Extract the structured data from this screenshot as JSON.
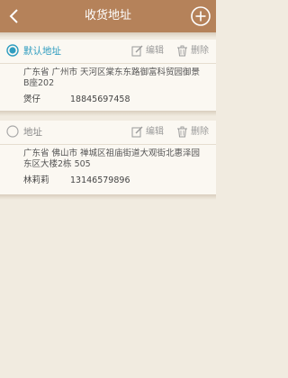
{
  "header": {
    "title": "收货地址",
    "back_icon": "chevron-left-icon",
    "add_icon": "circle-plus-icon",
    "bg_color": "#b5825a"
  },
  "actions": {
    "edit_label": "编辑",
    "delete_label": "删除"
  },
  "addresses": [
    {
      "label": "默认地址",
      "is_default": true,
      "address": "广东省 广州市 天河区棠东东路御富科贸园御景B座202",
      "name": "煲仔",
      "phone": "18845697458"
    },
    {
      "label": "地址",
      "is_default": false,
      "address": "广东省 佛山市 禅城区祖庙街道大观街北惠泽园东区大楼2栋 505",
      "name": "林莉莉",
      "phone": "13146579896"
    }
  ],
  "colors": {
    "accent": "#2f9dc0",
    "background": "#f1ebe0",
    "card": "#fbf8f2"
  }
}
